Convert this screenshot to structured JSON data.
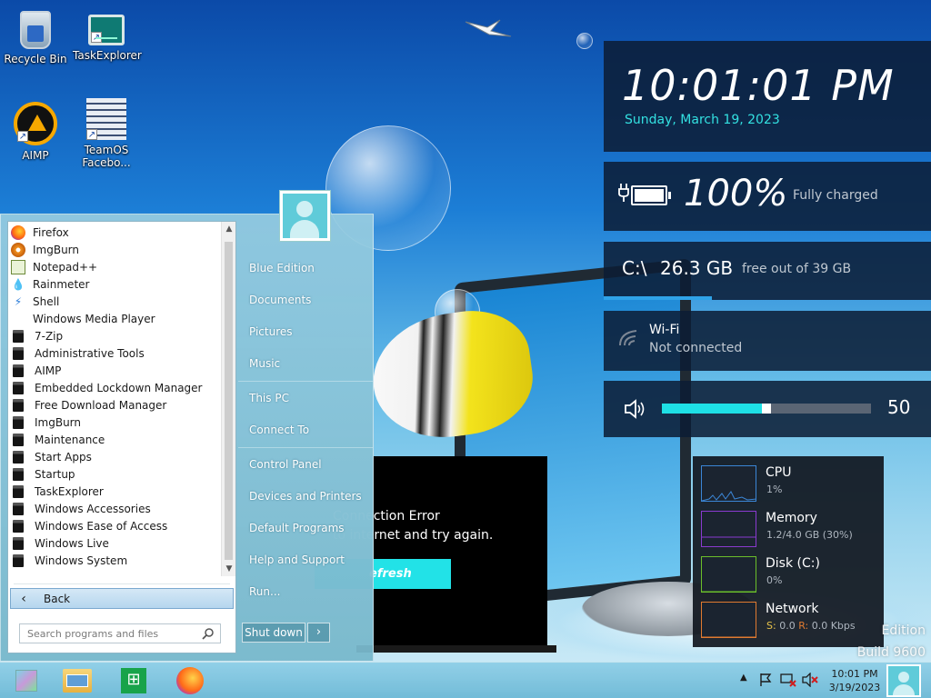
{
  "desktop": {
    "icons": [
      {
        "label": "Recycle Bin",
        "icon": "recycle-bin-icon"
      },
      {
        "label": "TaskExplorer",
        "icon": "task-explorer-icon"
      },
      {
        "label": "AIMP",
        "icon": "aimp-icon"
      },
      {
        "label": "TeamOS Facebo...",
        "icon": "teamos-icon"
      }
    ]
  },
  "start_menu": {
    "programs": [
      {
        "label": "Firefox",
        "icon": "firefox-icon"
      },
      {
        "label": "ImgBurn",
        "icon": "imgburn-icon"
      },
      {
        "label": "Notepad++",
        "icon": "notepad-icon"
      },
      {
        "label": "Rainmeter",
        "icon": "rainmeter-icon"
      },
      {
        "label": "Shell",
        "icon": "shell-icon"
      },
      {
        "label": "Windows Media Player",
        "icon": "none"
      },
      {
        "label": "7-Zip",
        "icon": "folder-icon"
      },
      {
        "label": "Administrative Tools",
        "icon": "folder-icon"
      },
      {
        "label": "AIMP",
        "icon": "folder-icon"
      },
      {
        "label": "Embedded Lockdown Manager",
        "icon": "folder-icon"
      },
      {
        "label": "Free Download Manager",
        "icon": "folder-icon"
      },
      {
        "label": "ImgBurn",
        "icon": "folder-icon"
      },
      {
        "label": "Maintenance",
        "icon": "folder-icon"
      },
      {
        "label": "Start Apps",
        "icon": "folder-icon"
      },
      {
        "label": "Startup",
        "icon": "folder-icon"
      },
      {
        "label": "TaskExplorer",
        "icon": "folder-icon"
      },
      {
        "label": "Windows Accessories",
        "icon": "folder-icon"
      },
      {
        "label": "Windows Ease of Access",
        "icon": "folder-icon"
      },
      {
        "label": "Windows Live",
        "icon": "folder-icon"
      },
      {
        "label": "Windows System",
        "icon": "folder-icon"
      }
    ],
    "back_label": "Back",
    "search_placeholder": "Search programs and files",
    "right_items": [
      "Blue Edition",
      "Documents",
      "Pictures",
      "Music",
      "This PC",
      "Connect To",
      "Control Panel",
      "Devices and Printers",
      "Default Programs",
      "Help and Support",
      "Run..."
    ],
    "shutdown_label": "Shut down"
  },
  "app_window": {
    "error_title": "Connection Error",
    "error_message": "to internet and try again.",
    "refresh_label": "efresh"
  },
  "widgets": {
    "clock": {
      "time": "10:01:01 PM",
      "date": "Sunday, March 19, 2023"
    },
    "battery": {
      "percent": "100%",
      "status": "Fully charged",
      "level": 1.0
    },
    "disk": {
      "drive": "C:\\",
      "free": "26.3 GB",
      "detail": "free out of 39 GB",
      "used_fraction": 0.33
    },
    "wifi": {
      "name": "Wi-Fi",
      "status": "Not connected"
    },
    "volume": {
      "value": "50",
      "level": 0.5
    },
    "perf": [
      {
        "name": "CPU",
        "value": "1%",
        "color": "#3b86d6"
      },
      {
        "name": "Memory",
        "value": "1.2/4.0 GB (30%)",
        "color": "#8a3ad0"
      },
      {
        "name": "Disk (C:)",
        "value": "0%",
        "color": "#6bbf2a"
      },
      {
        "name": "Network",
        "send_label": "S:",
        "send": "0.0",
        "recv_label": "R:",
        "recv": "0.0 Kbps",
        "color": "#e07a30"
      }
    ]
  },
  "watermark": {
    "line1": "Edition",
    "line2": "Build 9600"
  },
  "taskbar": {
    "apps": [
      "start-button",
      "file-explorer",
      "store",
      "firefox"
    ],
    "clock_time": "10:01 PM",
    "clock_date": "3/19/2023"
  }
}
